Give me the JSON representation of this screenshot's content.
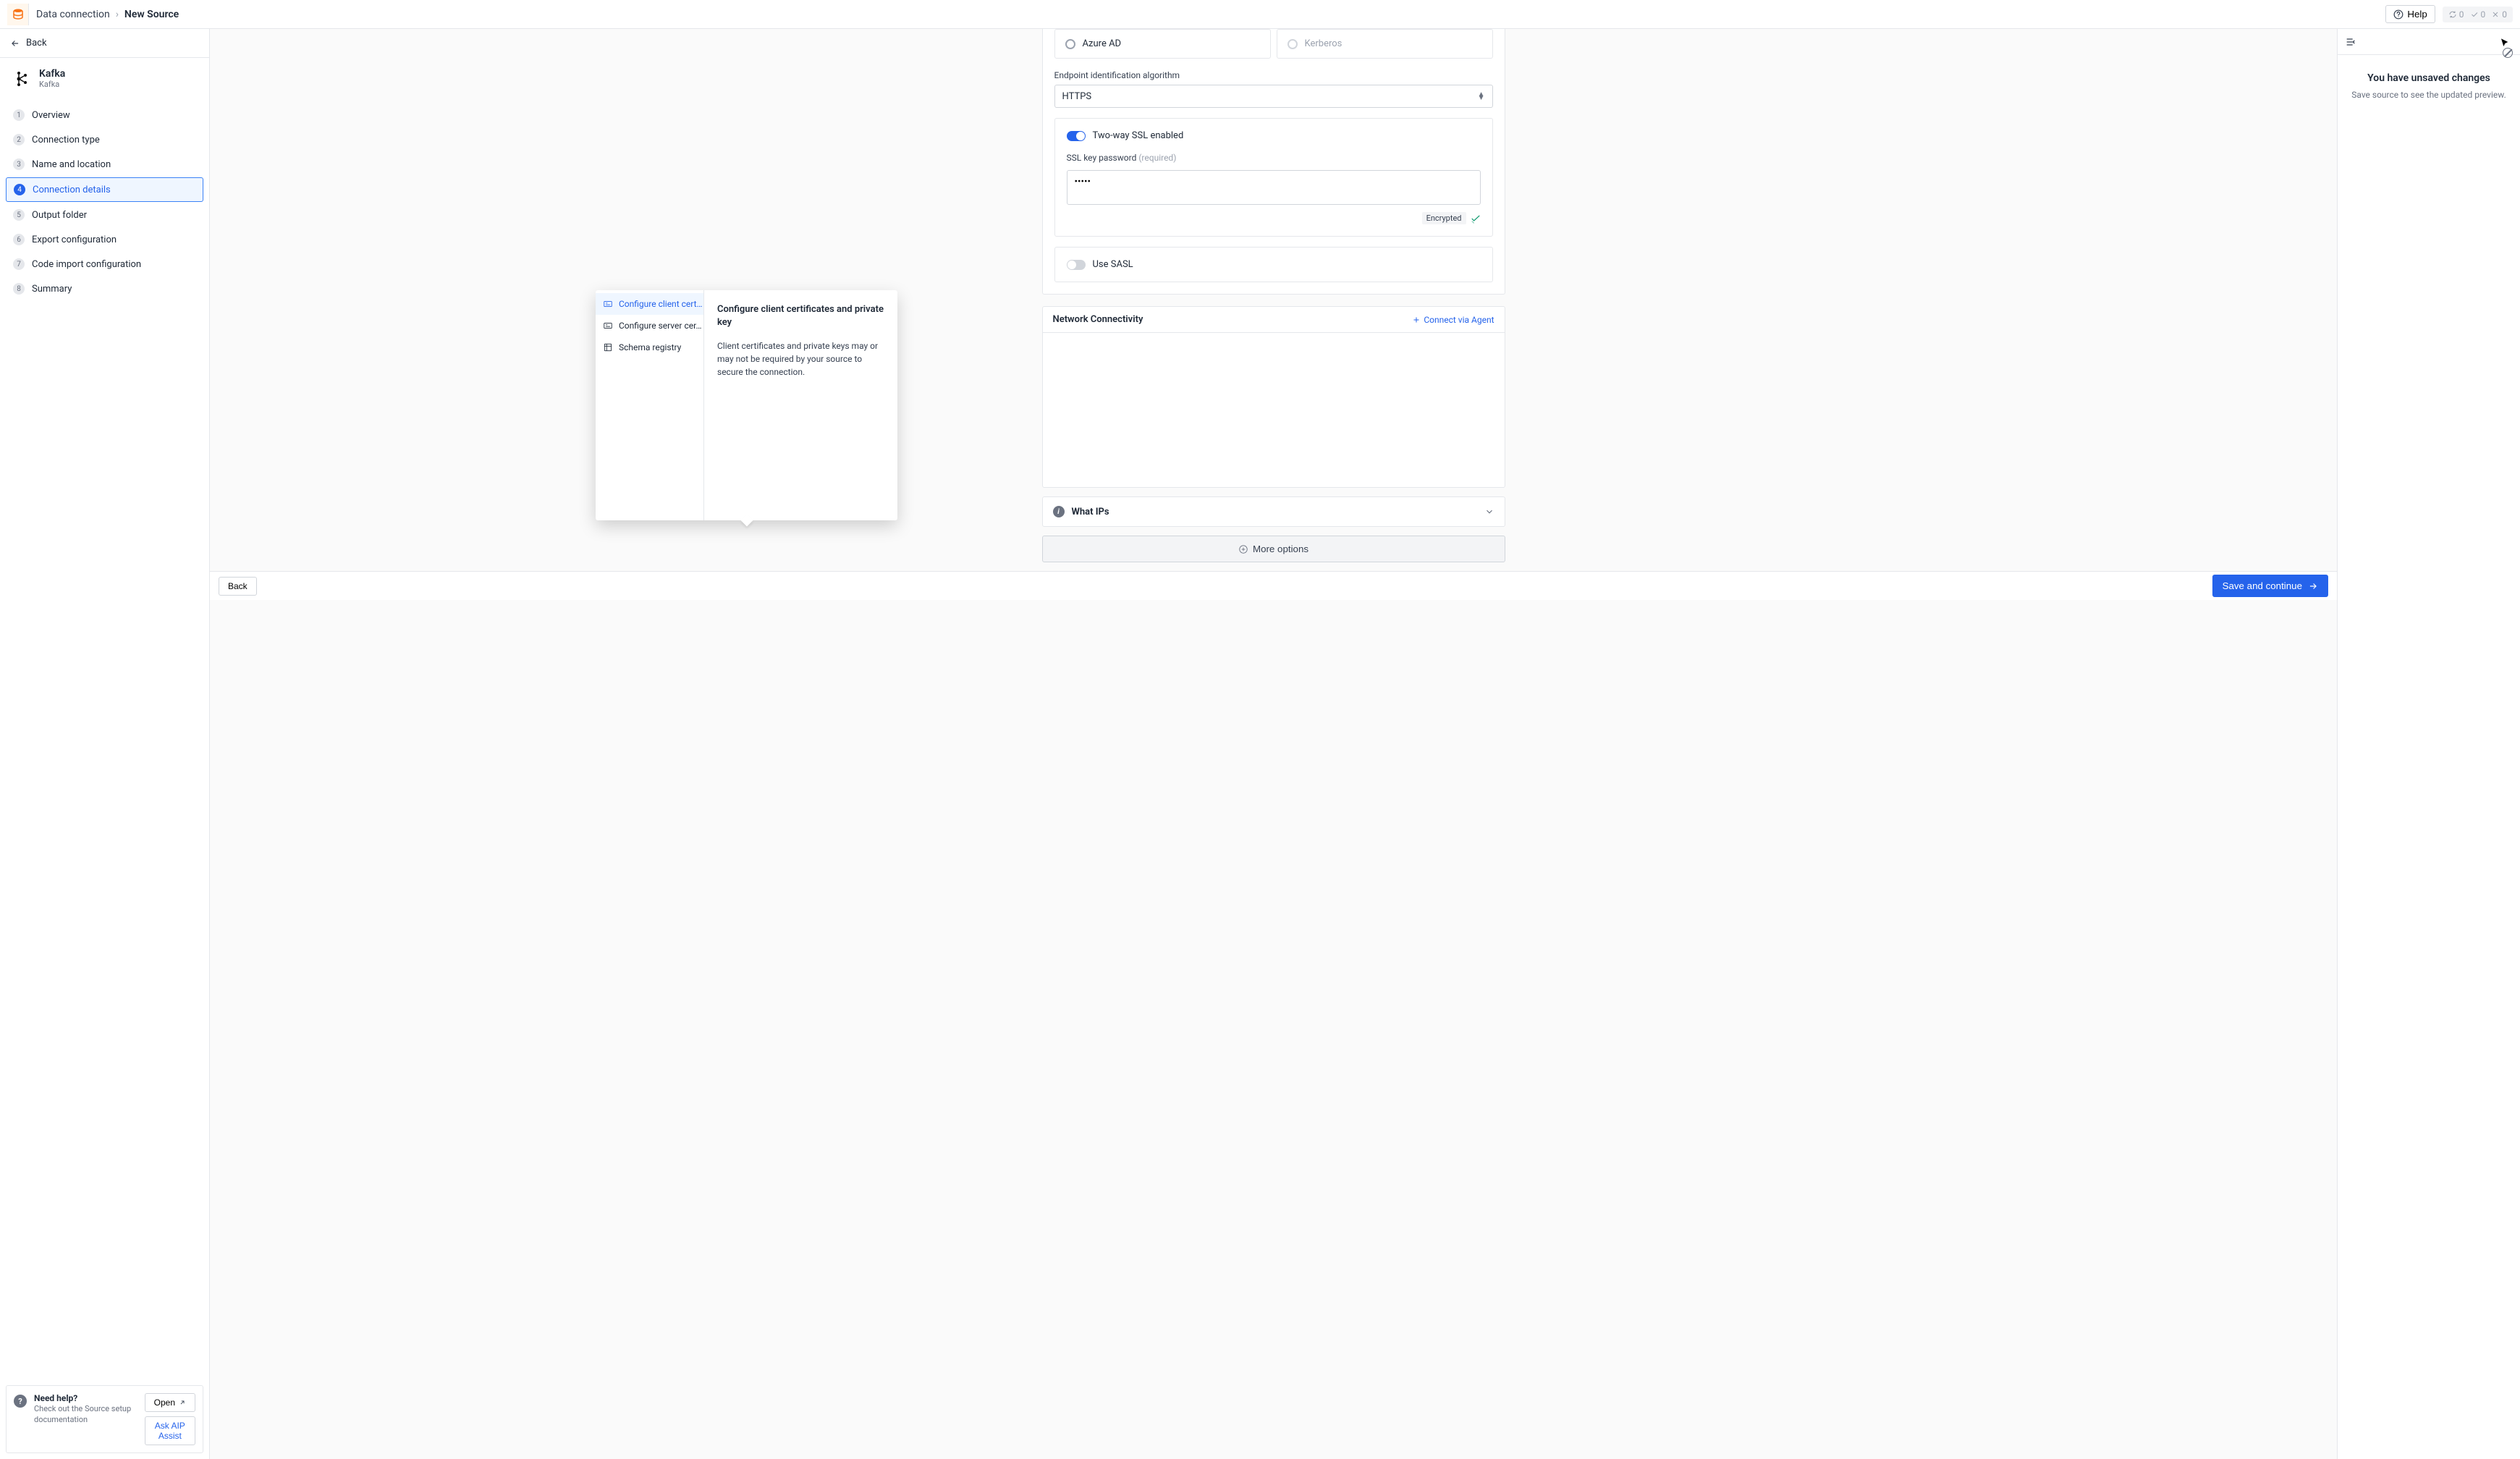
{
  "header": {
    "breadcrumb1": "Data connection",
    "breadcrumb2": "New Source",
    "help": "Help",
    "status_refresh": "0",
    "status_check": "0",
    "status_close": "0"
  },
  "sidebar": {
    "back": "Back",
    "source_title": "Kafka",
    "source_sub": "Kafka",
    "steps": [
      {
        "num": "1",
        "label": "Overview"
      },
      {
        "num": "2",
        "label": "Connection type"
      },
      {
        "num": "3",
        "label": "Name and location"
      },
      {
        "num": "4",
        "label": "Connection details"
      },
      {
        "num": "5",
        "label": "Output folder"
      },
      {
        "num": "6",
        "label": "Export configuration"
      },
      {
        "num": "7",
        "label": "Code import configuration"
      },
      {
        "num": "8",
        "label": "Summary"
      }
    ],
    "active_step": 3,
    "help_title": "Need help?",
    "help_sub": "Check out the Source setup documentation",
    "open_btn": "Open",
    "aip_btn": "Ask AIP Assist"
  },
  "form": {
    "radio_azure": "Azure AD",
    "radio_kerberos": "Kerberos",
    "endpoint_label": "Endpoint identification algorithm",
    "endpoint_value": "HTTPS",
    "two_way_ssl": "Two-way SSL enabled",
    "ssl_pwd_label": "SSL key password",
    "required_hint": "(required)",
    "ssl_pwd_value": "•••••",
    "encrypted": "Encrypted",
    "use_sasl": "Use SASL",
    "network_title": "Network Connectivity",
    "connect_agent": "Connect via Agent",
    "what_ips": "What IPs",
    "more_options": "More options"
  },
  "popover": {
    "items": [
      {
        "label": "Configure client cert…",
        "active": true
      },
      {
        "label": "Configure server cer…",
        "active": false
      },
      {
        "label": "Schema registry",
        "active": false
      }
    ],
    "title": "Configure client certificates and private key",
    "desc": "Client certificates and private keys may or may not be required by your source to secure the connection."
  },
  "bottom": {
    "back": "Back",
    "save": "Save and continue"
  },
  "right": {
    "title": "You have unsaved changes",
    "sub": "Save source to see the updated preview."
  }
}
